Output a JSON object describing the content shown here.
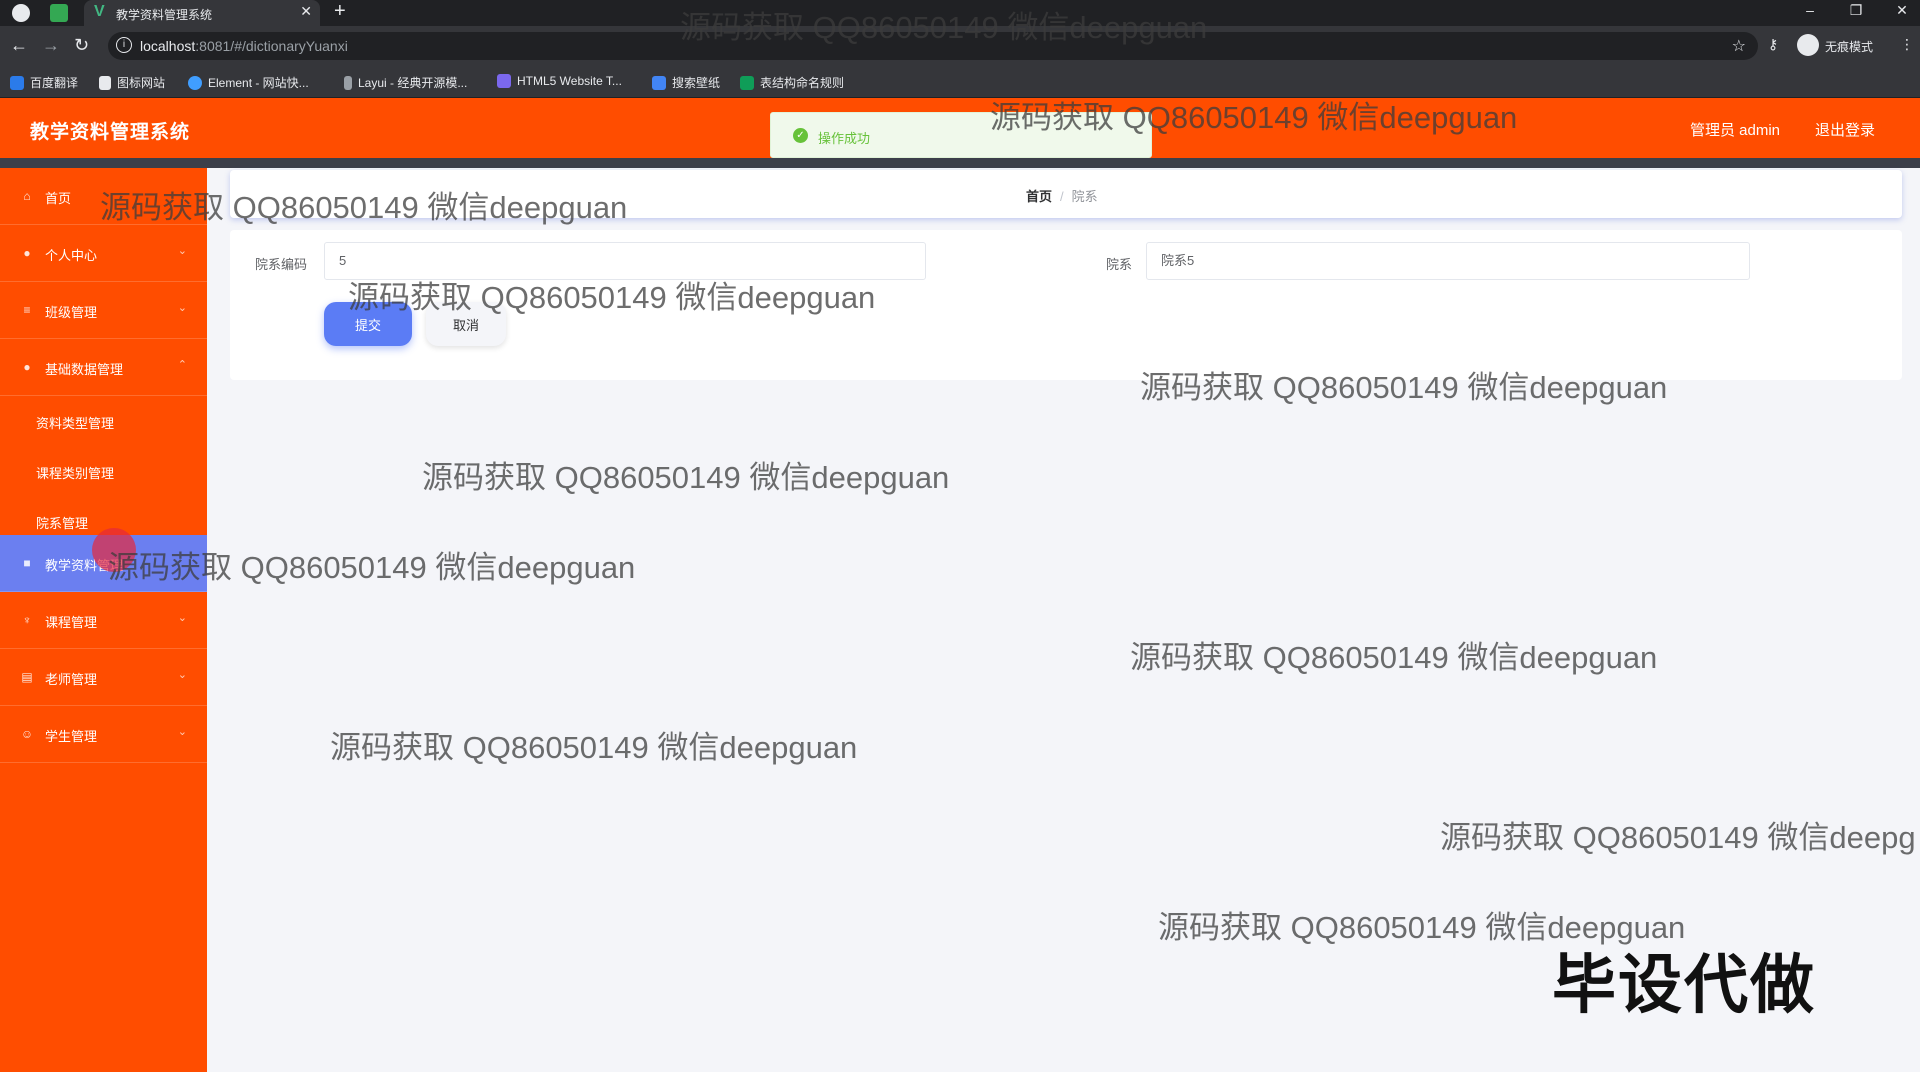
{
  "browser": {
    "tab_title": "教学资料管理系统",
    "tab_close": "✕",
    "new_tab": "+",
    "url_host": "localhost",
    "url_rest": ":8081/#/dictionaryYuanxi",
    "profile_label": "无痕模式",
    "bookmarks": [
      "百度翻译",
      "图标网站",
      "Element - 网站快...",
      "Layui - 经典开源模...",
      "HTML5 Website T...",
      "搜索壁纸",
      "表结构命名规则"
    ]
  },
  "header": {
    "title": "教学资料管理系统",
    "user_label": "管理员 admin",
    "logout_label": "退出登录"
  },
  "toast": {
    "icon": "✓",
    "text": "操作成功"
  },
  "sidebar": {
    "items": [
      {
        "label": "首页",
        "icon": "home-icon",
        "glyph": "⌂"
      },
      {
        "label": "个人中心",
        "icon": "user-icon",
        "glyph": "●"
      },
      {
        "label": "班级管理",
        "icon": "list-icon",
        "glyph": "≡"
      },
      {
        "label": "基础数据管理",
        "icon": "people-icon",
        "glyph": "●"
      },
      {
        "label": "教学资料管理",
        "icon": "doc-icon",
        "glyph": "■"
      },
      {
        "label": "课程管理",
        "icon": "course-icon",
        "glyph": "♆"
      },
      {
        "label": "老师管理",
        "icon": "teacher-icon",
        "glyph": "▤"
      },
      {
        "label": "学生管理",
        "icon": "student-icon",
        "glyph": "☺"
      }
    ],
    "subitems": [
      "资料类型管理",
      "课程类别管理",
      "院系管理"
    ]
  },
  "breadcrumb": {
    "home": "首页",
    "sep": "/",
    "current": "院系"
  },
  "form": {
    "code_label": "院系编码",
    "code_value": "5",
    "name_label": "院系",
    "name_value": "院系5",
    "submit_label": "提交",
    "cancel_label": "取消"
  },
  "watermark": {
    "text": "源码获取 QQ86050149 微信deepguan",
    "text_cut": "源码获取 QQ86050149 微信deepg",
    "big": "毕设代做"
  }
}
